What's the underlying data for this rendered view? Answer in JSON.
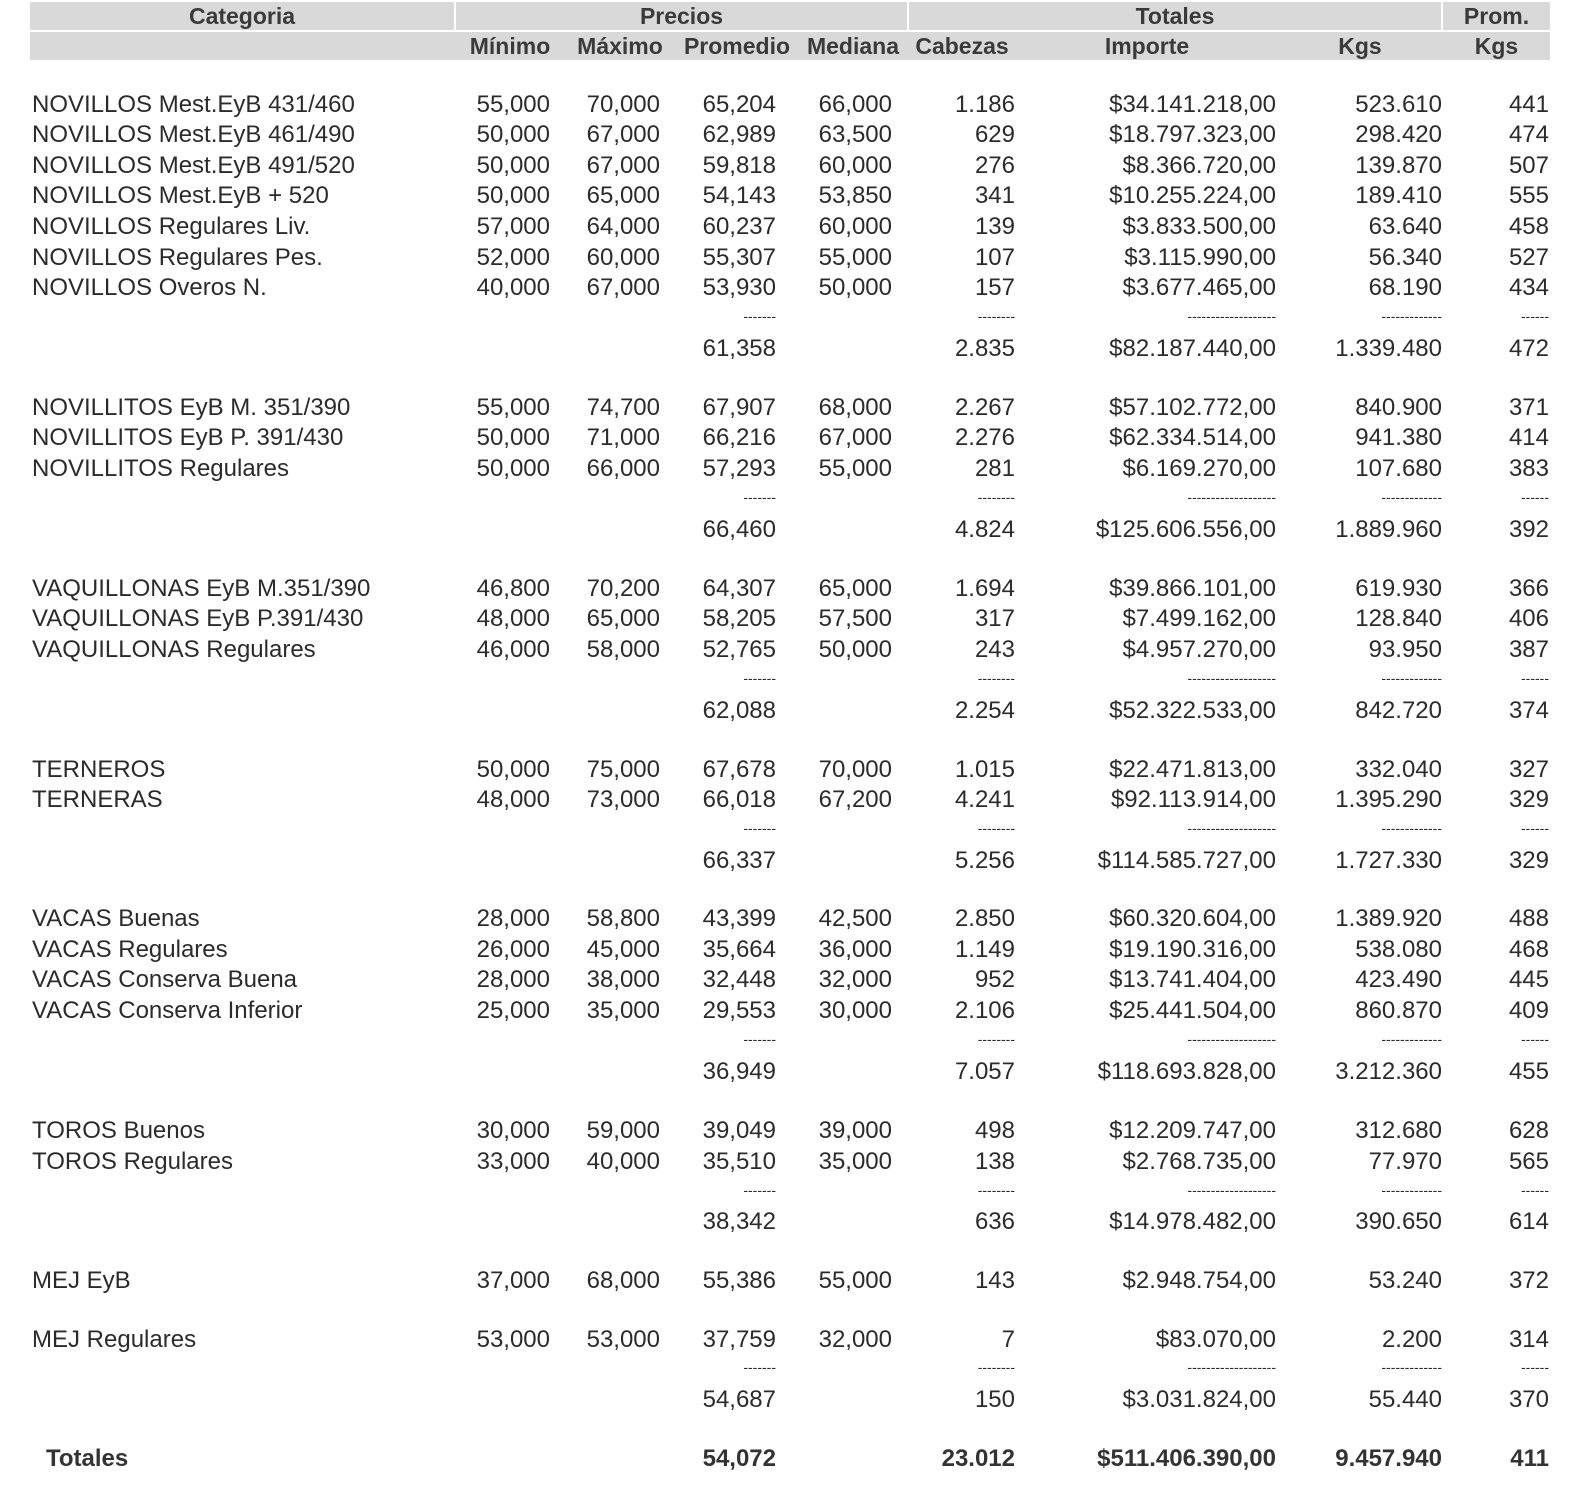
{
  "header": {
    "categoria": "Categoria",
    "precios": "Precios",
    "totales": "Totales",
    "prom": "Prom.",
    "minimo": "Mínimo",
    "maximo": "Máximo",
    "promedio": "Promedio",
    "mediana": "Mediana",
    "cabezas": "Cabezas",
    "importe": "Importe",
    "kgs": "Kgs",
    "prom_kgs": "Kgs"
  },
  "groups": [
    {
      "rows": [
        {
          "categoria": "NOVILLOS Mest.EyB 431/460",
          "minimo": "55,000",
          "maximo": "70,000",
          "promedio": "65,204",
          "mediana": "66,000",
          "cabezas": "1.186",
          "importe": "$34.141.218,00",
          "kgs": "523.610",
          "prom_kgs": "441"
        },
        {
          "categoria": "NOVILLOS Mest.EyB 461/490",
          "minimo": "50,000",
          "maximo": "67,000",
          "promedio": "62,989",
          "mediana": "63,500",
          "cabezas": "629",
          "importe": "$18.797.323,00",
          "kgs": "298.420",
          "prom_kgs": "474"
        },
        {
          "categoria": "NOVILLOS Mest.EyB 491/520",
          "minimo": "50,000",
          "maximo": "67,000",
          "promedio": "59,818",
          "mediana": "60,000",
          "cabezas": "276",
          "importe": "$8.366.720,00",
          "kgs": "139.870",
          "prom_kgs": "507"
        },
        {
          "categoria": "NOVILLOS Mest.EyB + 520",
          "minimo": "50,000",
          "maximo": "65,000",
          "promedio": "54,143",
          "mediana": "53,850",
          "cabezas": "341",
          "importe": "$10.255.224,00",
          "kgs": "189.410",
          "prom_kgs": "555"
        },
        {
          "categoria": "NOVILLOS Regulares Liv.",
          "minimo": "57,000",
          "maximo": "64,000",
          "promedio": "60,237",
          "mediana": "60,000",
          "cabezas": "139",
          "importe": "$3.833.500,00",
          "kgs": "63.640",
          "prom_kgs": "458"
        },
        {
          "categoria": "NOVILLOS Regulares Pes.",
          "minimo": "52,000",
          "maximo": "60,000",
          "promedio": "55,307",
          "mediana": "55,000",
          "cabezas": "107",
          "importe": "$3.115.990,00",
          "kgs": "56.340",
          "prom_kgs": "527"
        },
        {
          "categoria": "NOVILLOS Overos N.",
          "minimo": "40,000",
          "maximo": "67,000",
          "promedio": "53,930",
          "mediana": "50,000",
          "cabezas": "157",
          "importe": "$3.677.465,00",
          "kgs": "68.190",
          "prom_kgs": "434"
        }
      ],
      "subtotal": {
        "promedio": "61,358",
        "cabezas": "2.835",
        "importe": "$82.187.440,00",
        "kgs": "1.339.480",
        "prom_kgs": "472"
      }
    },
    {
      "rows": [
        {
          "categoria": "NOVILLITOS EyB M. 351/390",
          "minimo": "55,000",
          "maximo": "74,700",
          "promedio": "67,907",
          "mediana": "68,000",
          "cabezas": "2.267",
          "importe": "$57.102.772,00",
          "kgs": "840.900",
          "prom_kgs": "371"
        },
        {
          "categoria": "NOVILLITOS EyB P. 391/430",
          "minimo": "50,000",
          "maximo": "71,000",
          "promedio": "66,216",
          "mediana": "67,000",
          "cabezas": "2.276",
          "importe": "$62.334.514,00",
          "kgs": "941.380",
          "prom_kgs": "414"
        },
        {
          "categoria": "NOVILLITOS Regulares",
          "minimo": "50,000",
          "maximo": "66,000",
          "promedio": "57,293",
          "mediana": "55,000",
          "cabezas": "281",
          "importe": "$6.169.270,00",
          "kgs": "107.680",
          "prom_kgs": "383"
        }
      ],
      "subtotal": {
        "promedio": "66,460",
        "cabezas": "4.824",
        "importe": "$125.606.556,00",
        "kgs": "1.889.960",
        "prom_kgs": "392"
      }
    },
    {
      "rows": [
        {
          "categoria": "VAQUILLONAS EyB M.351/390",
          "minimo": "46,800",
          "maximo": "70,200",
          "promedio": "64,307",
          "mediana": "65,000",
          "cabezas": "1.694",
          "importe": "$39.866.101,00",
          "kgs": "619.930",
          "prom_kgs": "366"
        },
        {
          "categoria": "VAQUILLONAS EyB P.391/430",
          "minimo": "48,000",
          "maximo": "65,000",
          "promedio": "58,205",
          "mediana": "57,500",
          "cabezas": "317",
          "importe": "$7.499.162,00",
          "kgs": "128.840",
          "prom_kgs": "406"
        },
        {
          "categoria": "VAQUILLONAS Regulares",
          "minimo": "46,000",
          "maximo": "58,000",
          "promedio": "52,765",
          "mediana": "50,000",
          "cabezas": "243",
          "importe": "$4.957.270,00",
          "kgs": "93.950",
          "prom_kgs": "387"
        }
      ],
      "subtotal": {
        "promedio": "62,088",
        "cabezas": "2.254",
        "importe": "$52.322.533,00",
        "kgs": "842.720",
        "prom_kgs": "374"
      }
    },
    {
      "rows": [
        {
          "categoria": "TERNEROS",
          "minimo": "50,000",
          "maximo": "75,000",
          "promedio": "67,678",
          "mediana": "70,000",
          "cabezas": "1.015",
          "importe": "$22.471.813,00",
          "kgs": "332.040",
          "prom_kgs": "327"
        },
        {
          "categoria": "TERNERAS",
          "minimo": "48,000",
          "maximo": "73,000",
          "promedio": "66,018",
          "mediana": "67,200",
          "cabezas": "4.241",
          "importe": "$92.113.914,00",
          "kgs": "1.395.290",
          "prom_kgs": "329"
        }
      ],
      "subtotal": {
        "promedio": "66,337",
        "cabezas": "5.256",
        "importe": "$114.585.727,00",
        "kgs": "1.727.330",
        "prom_kgs": "329"
      }
    },
    {
      "rows": [
        {
          "categoria": "VACAS Buenas",
          "minimo": "28,000",
          "maximo": "58,800",
          "promedio": "43,399",
          "mediana": "42,500",
          "cabezas": "2.850",
          "importe": "$60.320.604,00",
          "kgs": "1.389.920",
          "prom_kgs": "488"
        },
        {
          "categoria": "VACAS Regulares",
          "minimo": "26,000",
          "maximo": "45,000",
          "promedio": "35,664",
          "mediana": "36,000",
          "cabezas": "1.149",
          "importe": "$19.190.316,00",
          "kgs": "538.080",
          "prom_kgs": "468"
        },
        {
          "categoria": "VACAS Conserva Buena",
          "minimo": "28,000",
          "maximo": "38,000",
          "promedio": "32,448",
          "mediana": "32,000",
          "cabezas": "952",
          "importe": "$13.741.404,00",
          "kgs": "423.490",
          "prom_kgs": "445"
        },
        {
          "categoria": "VACAS Conserva Inferior",
          "minimo": "25,000",
          "maximo": "35,000",
          "promedio": "29,553",
          "mediana": "30,000",
          "cabezas": "2.106",
          "importe": "$25.441.504,00",
          "kgs": "860.870",
          "prom_kgs": "409"
        }
      ],
      "subtotal": {
        "promedio": "36,949",
        "cabezas": "7.057",
        "importe": "$118.693.828,00",
        "kgs": "3.212.360",
        "prom_kgs": "455"
      }
    },
    {
      "rows": [
        {
          "categoria": "TOROS Buenos",
          "minimo": "30,000",
          "maximo": "59,000",
          "promedio": "39,049",
          "mediana": "39,000",
          "cabezas": "498",
          "importe": "$12.209.747,00",
          "kgs": "312.680",
          "prom_kgs": "628"
        },
        {
          "categoria": "TOROS Regulares",
          "minimo": "33,000",
          "maximo": "40,000",
          "promedio": "35,510",
          "mediana": "35,000",
          "cabezas": "138",
          "importe": "$2.768.735,00",
          "kgs": "77.970",
          "prom_kgs": "565"
        }
      ],
      "subtotal": {
        "promedio": "38,342",
        "cabezas": "636",
        "importe": "$14.978.482,00",
        "kgs": "390.650",
        "prom_kgs": "614"
      }
    },
    {
      "rows": [
        {
          "categoria": "MEJ EyB",
          "minimo": "37,000",
          "maximo": "68,000",
          "promedio": "55,386",
          "mediana": "55,000",
          "cabezas": "143",
          "importe": "$2.948.754,00",
          "kgs": "53.240",
          "prom_kgs": "372"
        },
        {
          "categoria": "MEJ Regulares",
          "minimo": "53,000",
          "maximo": "53,000",
          "promedio": "37,759",
          "mediana": "32,000",
          "cabezas": "7",
          "importe": "$83.070,00",
          "kgs": "2.200",
          "prom_kgs": "314"
        }
      ],
      "subtotal": {
        "promedio": "54,687",
        "cabezas": "150",
        "importe": "$3.031.824,00",
        "kgs": "55.440",
        "prom_kgs": "370"
      }
    }
  ],
  "dashes": {
    "promedio": "-------",
    "cabezas": "--------",
    "importe": "-------------------",
    "kgs": "-------------",
    "prom_kgs": "------"
  },
  "totals": {
    "label": "Totales",
    "promedio": "54,072",
    "cabezas": "23.012",
    "importe": "$511.406.390,00",
    "kgs": "9.457.940",
    "prom_kgs": "411"
  }
}
